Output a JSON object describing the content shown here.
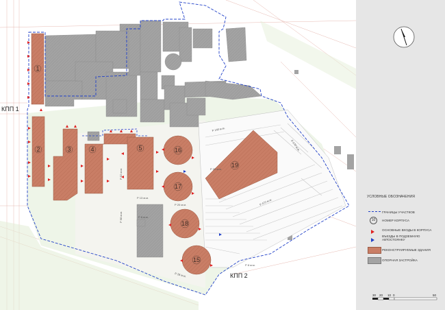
{
  "gates": {
    "kpp1": "КПП 1",
    "kpp2": "КПП 2"
  },
  "buildings": [
    {
      "id": "b1",
      "label": "1"
    },
    {
      "id": "b2",
      "label": "2"
    },
    {
      "id": "b3",
      "label": "3"
    },
    {
      "id": "b4",
      "label": "4"
    },
    {
      "id": "b5",
      "label": "5"
    },
    {
      "id": "b15",
      "label": "15"
    },
    {
      "id": "b16",
      "label": "16"
    },
    {
      "id": "b17",
      "label": "17"
    },
    {
      "id": "b18",
      "label": "18"
    },
    {
      "id": "b19",
      "label": "19"
    }
  ],
  "road_labels": {
    "r1": "Р 140 м.м.",
    "r2": "Р 170 м.м.",
    "r3": "Р 472 м.м.",
    "r4": "Р 20 м.м.",
    "r5": "Р 20 м.м.",
    "r6": "Р 13 м.м.",
    "r7": "Р 52 м.м.",
    "r8": "Р 68 м.м.",
    "r9": "Р 8 м.м.",
    "r10": "Р 28 м.м.",
    "r11": "Р 8 м.м."
  },
  "legend": {
    "title": "УСЛОВНЫЕ ОБОЗНАЧЕНИЯ",
    "items": [
      {
        "key": "boundary",
        "text": "ГРАНИЦЫ УЧАСТКОВ"
      },
      {
        "key": "number",
        "symbol": "10",
        "text": "НОМЕР КОРПУСА"
      },
      {
        "key": "entrance",
        "text": "ОСНОВНЫЕ ВХОДЫ В КОРПУСА"
      },
      {
        "key": "ramp",
        "text": "ВЪЕЗДЫ В ПОДЗЕМНУЮ АВТОСТОЯНКУ"
      },
      {
        "key": "reconstructed",
        "text": "РЕКОНСТРУИРУЕМЫЕ ЗДАНИЯ"
      },
      {
        "key": "existing",
        "text": "ОПОРНАЯ ЗАСТРОЙКА"
      }
    ]
  },
  "scale": {
    "ticks": [
      "30",
      "20",
      "10",
      "0",
      "50"
    ]
  },
  "colors": {
    "reconstructed": "#c97e66",
    "existing": "#a3a3a3",
    "boundary": "#2040c8",
    "entrance": "#e02020",
    "green": "#cfe3c0",
    "panel": "#e6e6e6"
  }
}
